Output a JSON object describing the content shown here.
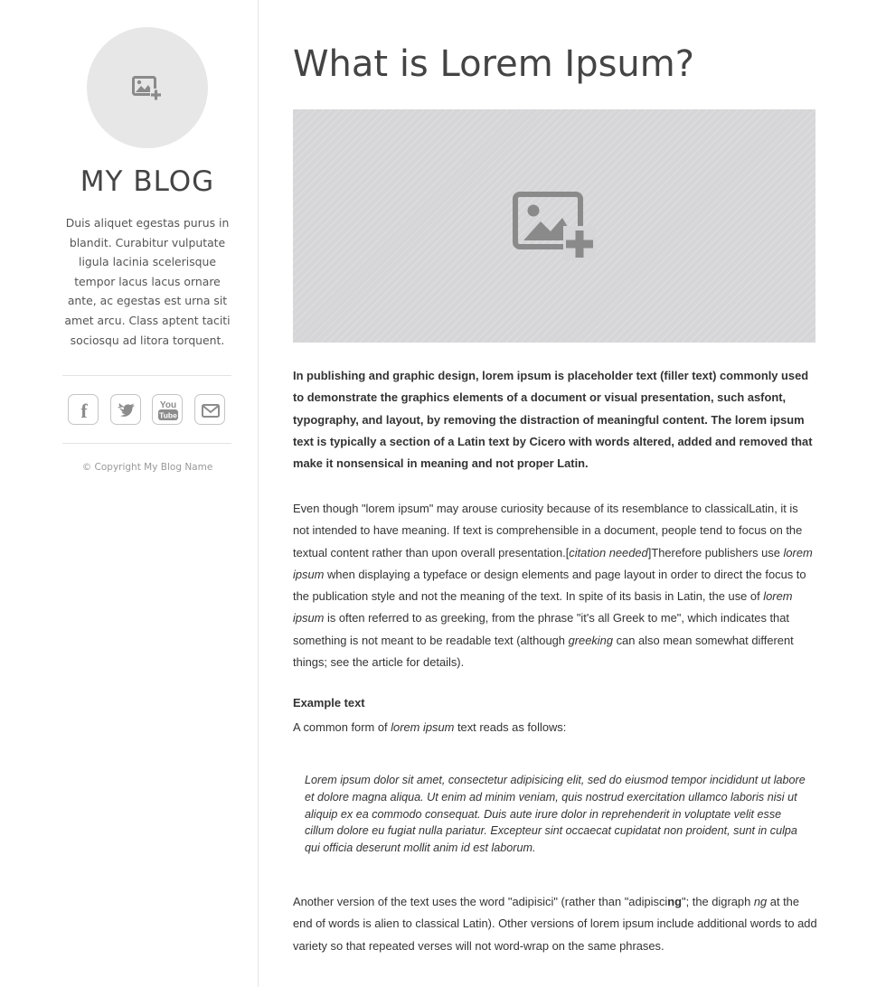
{
  "sidebar": {
    "avatar_icon": "add-image-icon",
    "blog_title": "MY BLOG",
    "description": "Duis aliquet egestas purus in blandit. Curabitur vulputate ligula lacinia scelerisque tempor lacus lacus ornare ante, ac egestas est urna sit amet arcu. Class aptent taciti sociosqu ad litora torquent.",
    "social": [
      {
        "name": "facebook-icon",
        "glyph": "f"
      },
      {
        "name": "twitter-icon",
        "glyph": "bird"
      },
      {
        "name": "youtube-icon",
        "glyph_top": "You",
        "glyph_bottom": "Tube"
      },
      {
        "name": "email-icon",
        "glyph": "envelope"
      }
    ],
    "copyright": "© Copyright My Blog Name"
  },
  "post": {
    "title": "What is Lorem Ipsum?",
    "hero_icon": "add-image-icon",
    "lead": "In publishing and graphic design, lorem ipsum is placeholder text (filler text) commonly used to demonstrate the graphics elements of a document or visual presentation, such asfont, typography, and layout, by removing the distraction of meaningful content. The lorem ipsum text is typically a section of a Latin text by Cicero with words altered, added and removed that make it nonsensical in meaning and not proper Latin.",
    "p1": {
      "t1": "Even though \"lorem ipsum\" may arouse curiosity because of its resemblance to classicalLatin, it is not intended to have meaning. If text is comprehensible in a document, people tend to focus on the textual content rather than upon overall presentation.[",
      "citation": "citation needed",
      "t2": "]Therefore publishers use ",
      "i1": "lorem ipsum",
      "t3": " when displaying a typeface or design elements and page layout in order to direct the focus to the publication style and not the meaning of the text. In spite of its basis in Latin, the use of ",
      "i2": "lorem ipsum",
      "t4": " is often referred to as greeking, from the phrase \"it's all Greek to me\", which indicates that something is not meant to be readable text (although ",
      "i3": "greeking",
      "t5": " can also mean somewhat different things; see the article for details)."
    },
    "example_heading": "Example text",
    "example_intro": {
      "t1": "A common form of ",
      "i1": "lorem ipsum",
      "t2": " text reads as follows:"
    },
    "quote": "Lorem ipsum dolor sit amet, consectetur adipisicing elit, sed do eiusmod tempor incididunt ut labore et dolore magna aliqua. Ut enim ad minim veniam, quis nostrud exercitation ullamco laboris nisi ut aliquip ex ea commodo consequat. Duis aute irure dolor in reprehenderit in voluptate velit esse cillum dolore eu fugiat nulla pariatur. Excepteur sint occaecat cupidatat non proident, sunt in culpa qui officia deserunt mollit anim id est laborum.",
    "p2": {
      "t1": "Another version of the text uses the word \"adipisici\" (rather than \"adipisci",
      "b1": "ng",
      "t2": "\"; the digraph ",
      "i1": "ng",
      "t3": " at the end of words is alien to classical Latin). Other versions of lorem ipsum include additional words to add variety so that repeated verses will not word-wrap on the same phrases."
    }
  },
  "colors": {
    "background": "#ffffff",
    "avatar_bg": "#e7e7e7",
    "hero_bg": "#d6d6d8",
    "icon_gray": "#8a8a8a",
    "text": "#333333"
  }
}
